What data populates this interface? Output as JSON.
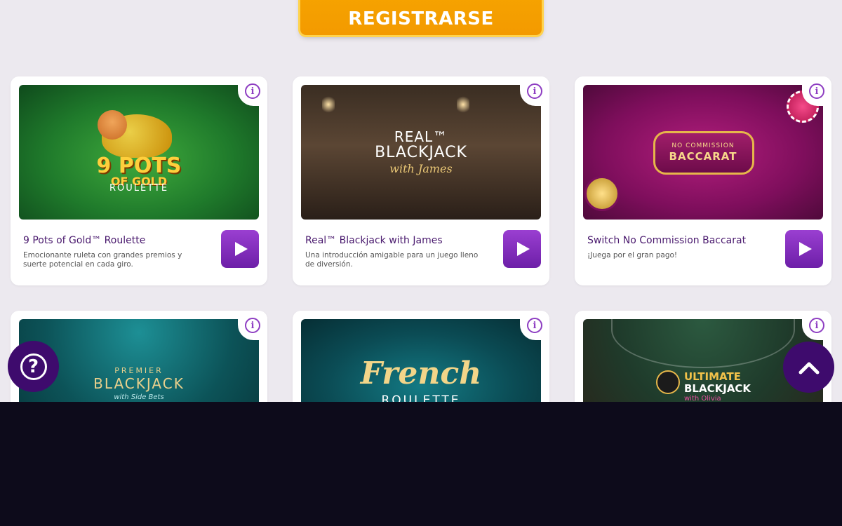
{
  "header": {
    "register_label": "REGISTRARSE"
  },
  "games": [
    {
      "title": "9 Pots of Gold™ Roulette",
      "description": "Emocionante ruleta con grandes premios y suerte potencial en cada giro.",
      "thumb_line1": "9 POTS",
      "thumb_line2": "OF GOLD",
      "thumb_line3": "ROULETTE"
    },
    {
      "title": "Real™ Blackjack with James",
      "description": "Una introducción amigable para un juego lleno de diversión.",
      "thumb_line1": "REAL™",
      "thumb_line2": "BLACKJACK",
      "thumb_line3": "with James"
    },
    {
      "title": "Switch No Commission Baccarat",
      "description": "¡Juega por el gran pago!",
      "thumb_line1": "NO COMMISSION",
      "thumb_line2": "BACCARAT"
    },
    {
      "thumb_line1": "PREMIER",
      "thumb_line2": "BLACKJACK",
      "thumb_line3": "with Side Bets"
    },
    {
      "thumb_line1": "French",
      "thumb_line2": "ROULETTE"
    },
    {
      "thumb_line1": "ULTIMATE",
      "thumb_line2": "BLACKJACK",
      "thumb_line3": "with Olivia"
    }
  ],
  "controls": {
    "info_symbol": "i",
    "help_symbol": "?"
  },
  "colors": {
    "accent": "#f39a00",
    "purple": "#6d1fa8",
    "dark": "#0d0b1b"
  }
}
